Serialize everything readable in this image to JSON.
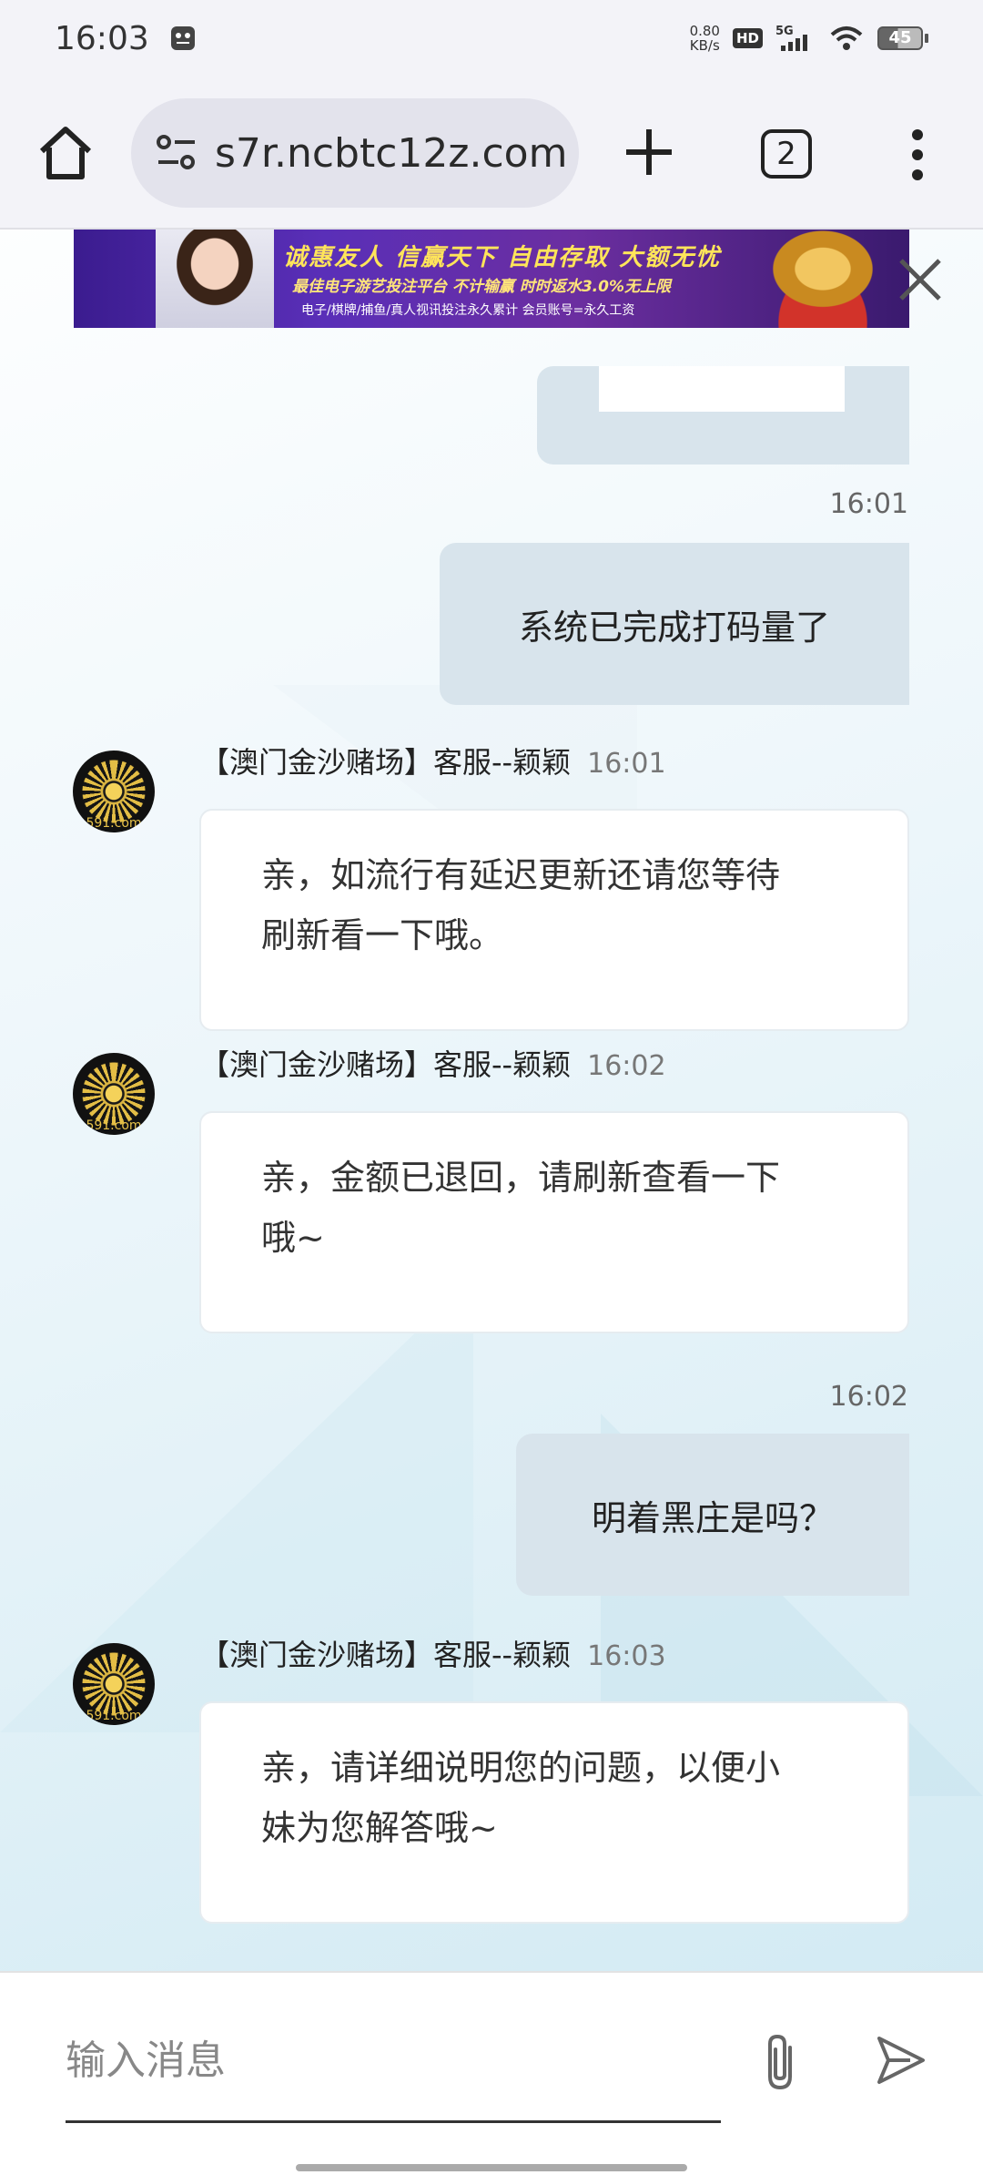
{
  "status_bar": {
    "time": "16:03",
    "net_speed_value": "0.80",
    "net_speed_unit": "KB/s",
    "hd": "HD",
    "network": "5G",
    "battery": "45"
  },
  "browser": {
    "url_visible": "s7r.ncbtc12z.com",
    "tab_count": "2"
  },
  "ad": {
    "line1": "诚惠友人 信赢天下 自由存取 大额无忧",
    "line2": "最佳电子游艺投注平台 不计输赢 时时返水3.0%无上限",
    "line3": "电子/棋牌/捕鱼/真人视讯投注永久累计 会员账号=永久工资"
  },
  "messages": [
    {
      "time": "16:01",
      "text": "系统已完成打码量了"
    },
    {
      "sender": "【澳门金沙赌场】客服--颖颖",
      "time": "16:01",
      "line1": "亲，如流行有延迟更新还请您等待",
      "line2": "刷新看一下哦。"
    },
    {
      "sender": "【澳门金沙赌场】客服--颖颖",
      "time": "16:02",
      "line1": "亲，金额已退回，请刷新查看一下",
      "line2": "哦~"
    },
    {
      "time": "16:02",
      "text": "明着黑庄是吗？"
    },
    {
      "sender": "【澳门金沙赌场】客服--颖颖",
      "time": "16:03",
      "line1": "亲，请详细说明您的问题，以便小",
      "line2": "妹为您解答哦~"
    }
  ],
  "avatar_text": "591.com",
  "input": {
    "placeholder": "输入消息"
  }
}
